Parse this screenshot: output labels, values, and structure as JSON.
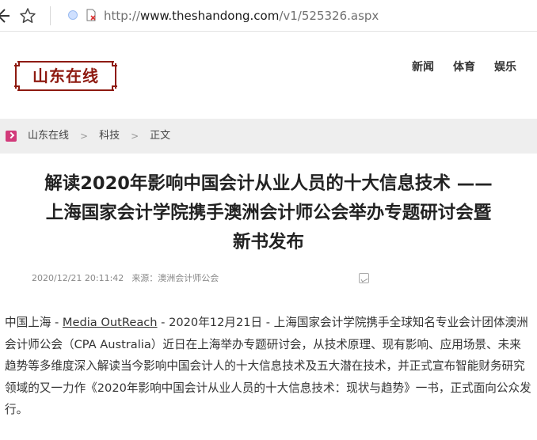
{
  "browser": {
    "url_scheme": "http://",
    "url_host": "www.theshandong.com",
    "url_path": "/v1/525326.aspx"
  },
  "site": {
    "logo_text": "山东在线",
    "nav": [
      "新闻",
      "体育",
      "娱乐"
    ]
  },
  "breadcrumb": {
    "items": [
      "山东在线",
      "科技",
      "正文"
    ],
    "separator": ">"
  },
  "article": {
    "title_line1": "解读2020年影响中国会计从业人员的十大信息技术 ——",
    "title_line2": "上海国家会计学院携手澳洲会计师公会举办专题研讨会暨",
    "title_line3": "新书发布",
    "date": "2020/12/21 20:11:42",
    "source": "来源：澳洲会计师公会",
    "body_prefix": "中国上海 - ",
    "body_link": "Media OutReach",
    "body_text": " - 2020年12月21日 - 上海国家会计学院携手全球知名专业会计团体澳洲会计师公会（CPA Australia）近日在上海举办专题研讨会，从技术原理、现有影响、应用场景、未来趋势等多维度深入解读当今影响中国会计人的十大信息技术及五大潜在技术，并正式宣布智能财务研究领域的又一力作《2020年影响中国会计从业人员的十大信息技术：现状与趋势》一书，正式面向公众发行。"
  },
  "colors": {
    "logo_red": "#8e1a10",
    "breadcrumb_bg": "#eeeeee",
    "breadcrumb_icon": "#d23a7a"
  }
}
